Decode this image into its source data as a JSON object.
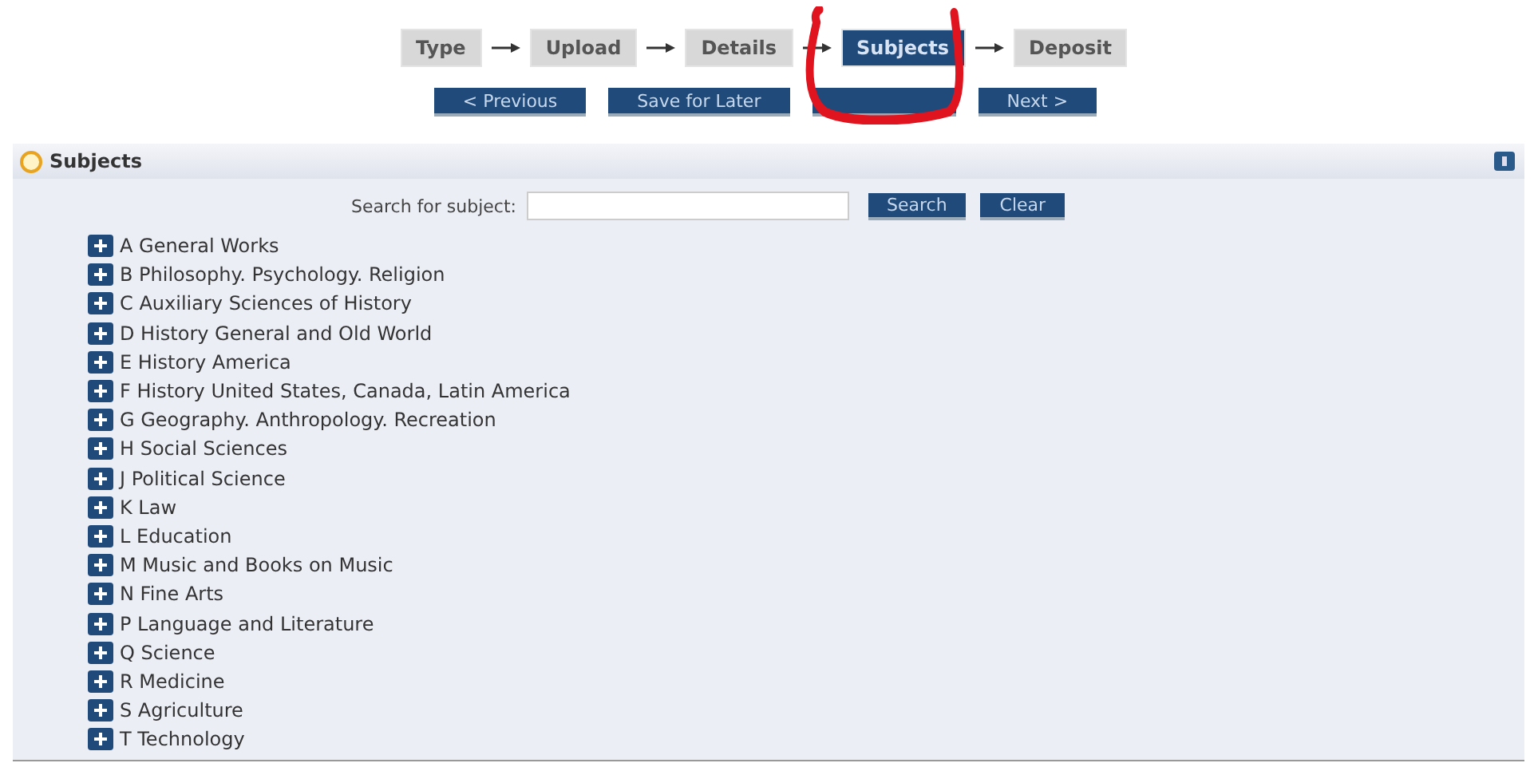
{
  "steps": [
    {
      "label": "Type",
      "selected": false
    },
    {
      "label": "Upload",
      "selected": false
    },
    {
      "label": "Details",
      "selected": false
    },
    {
      "label": "Subjects",
      "selected": true
    },
    {
      "label": "Deposit",
      "selected": false
    }
  ],
  "nav_buttons": [
    {
      "kind": "button",
      "label": "< Previous"
    },
    {
      "kind": "button",
      "label": "Save for Later"
    },
    {
      "kind": "covered"
    },
    {
      "kind": "button",
      "label": "Next >"
    }
  ],
  "annotation": {
    "kind": "circle"
  },
  "panel": {
    "title": "Subjects",
    "search_label": "Search for subject:",
    "search_buttons": [
      "Search",
      "Clear"
    ],
    "subjects": [
      {
        "label": "A General Works",
        "expanded": false
      },
      {
        "label": "B Philosophy. Psychology. Religion",
        "expanded": false
      },
      {
        "label": "C Auxiliary Sciences of History",
        "expanded": false
      },
      {
        "label": "D History General and Old World",
        "expanded": false
      },
      {
        "label": "E History America",
        "expanded": false
      },
      {
        "label": "F History United States, Canada, Latin America",
        "expanded": false
      },
      {
        "label": "G Geography. Anthropology. Recreation",
        "expanded": false
      },
      {
        "label": "H Social Sciences",
        "expanded": false
      },
      {
        "label": "J Political Science",
        "expanded": false
      },
      {
        "label": "K Law",
        "expanded": false
      },
      {
        "label": "L Education",
        "expanded": false
      },
      {
        "label": "M Music and Books on Music",
        "expanded": false
      },
      {
        "label": "N Fine Arts",
        "expanded": false
      },
      {
        "label": "P Language and Literature",
        "expanded": false
      },
      {
        "label": "Q Science",
        "expanded": false
      },
      {
        "label": "R Medicine",
        "expanded": false
      },
      {
        "label": "S Agriculture",
        "expanded": false
      },
      {
        "label": "T Technology",
        "expanded": false
      }
    ]
  }
}
